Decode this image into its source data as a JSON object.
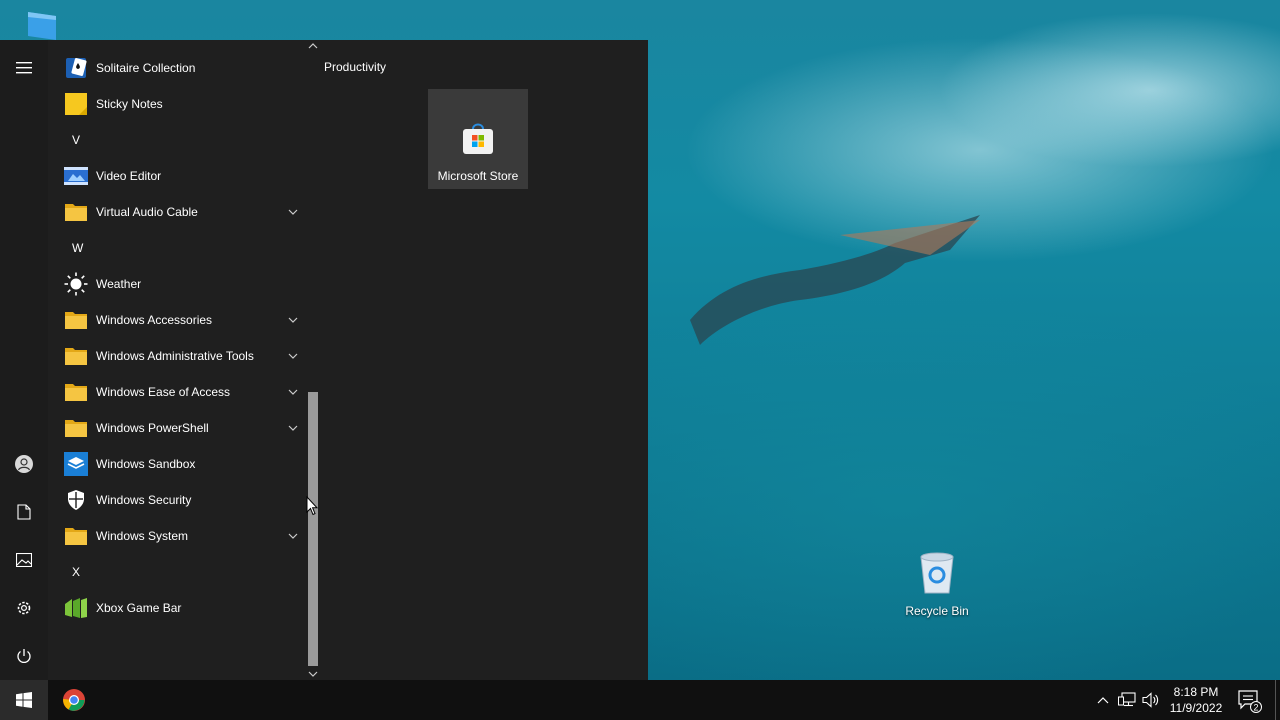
{
  "desktop": {
    "icons": [
      {
        "label": "Recycle Bin"
      }
    ]
  },
  "start_menu": {
    "rail": {
      "items": [
        {
          "icon": "hamburger-menu-icon"
        },
        {
          "icon": "user-account-icon"
        },
        {
          "icon": "documents-icon"
        },
        {
          "icon": "pictures-icon"
        },
        {
          "icon": "settings-gear-icon"
        },
        {
          "icon": "power-icon"
        }
      ]
    },
    "apps": [
      {
        "label": "Solitaire Collection",
        "icon": "solitaire-icon",
        "expandable": false
      },
      {
        "label": "Sticky Notes",
        "icon": "sticky-notes-icon",
        "expandable": false
      },
      {
        "letter": "V"
      },
      {
        "label": "Video Editor",
        "icon": "video-editor-icon",
        "expandable": false
      },
      {
        "label": "Virtual Audio Cable",
        "icon": "folder-icon",
        "expandable": true
      },
      {
        "letter": "W"
      },
      {
        "label": "Weather",
        "icon": "weather-sun-icon",
        "expandable": false
      },
      {
        "label": "Windows Accessories",
        "icon": "folder-icon",
        "expandable": true
      },
      {
        "label": "Windows Administrative Tools",
        "icon": "folder-icon",
        "expandable": true
      },
      {
        "label": "Windows Ease of Access",
        "icon": "folder-icon",
        "expandable": true
      },
      {
        "label": "Windows PowerShell",
        "icon": "folder-icon",
        "expandable": true
      },
      {
        "label": "Windows Sandbox",
        "icon": "sandbox-icon",
        "expandable": false
      },
      {
        "label": "Windows Security",
        "icon": "shield-icon",
        "expandable": false
      },
      {
        "label": "Windows System",
        "icon": "folder-icon",
        "expandable": true
      },
      {
        "letter": "X"
      },
      {
        "label": "Xbox Game Bar",
        "icon": "xbox-game-bar-icon",
        "expandable": false
      }
    ],
    "tiles": {
      "group_title": "Productivity",
      "items": [
        {
          "label": "Microsoft Store",
          "icon": "microsoft-store-icon"
        }
      ]
    }
  },
  "taskbar": {
    "start_icon": "windows-logo-icon",
    "pinned": [
      {
        "icon": "chrome-icon"
      }
    ],
    "tray": {
      "time": "8:18 PM",
      "date": "11/9/2022",
      "notification_count": "2"
    }
  },
  "colors": {
    "start_bg": "#1f1f1f",
    "tile_bg": "#3a3a3a",
    "taskbar_bg": "#101010",
    "folder_yellow": "#f5c542"
  }
}
